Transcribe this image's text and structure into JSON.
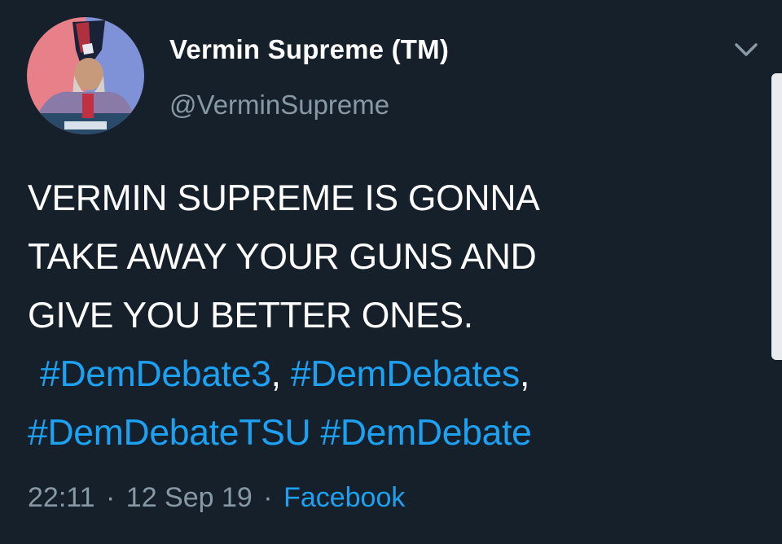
{
  "tweet": {
    "author": {
      "display_name": "Vermin Supreme (TM)",
      "handle": "@VerminSupreme",
      "avatar_icon": "profile-photo"
    },
    "text_lines": [
      "VERMIN SUPREME IS GONNA",
      "TAKE AWAY YOUR GUNS AND",
      "GIVE YOU BETTER ONES."
    ],
    "hashtags": {
      "tag1": "#DemDebate3",
      "sep1": ",",
      "tag2": "#DemDebates",
      "sep2": ",",
      "tag3": "#DemDebateTSU",
      "tag4": "#DemDebate"
    },
    "meta": {
      "time": "22:11",
      "separator": "·",
      "date": "12 Sep 19",
      "source": "Facebook"
    },
    "menu_icon": "chevron-down-icon"
  },
  "colors": {
    "background": "#15202b",
    "text": "#ffffff",
    "secondary_text": "#8899a6",
    "link": "#1da1f2"
  }
}
